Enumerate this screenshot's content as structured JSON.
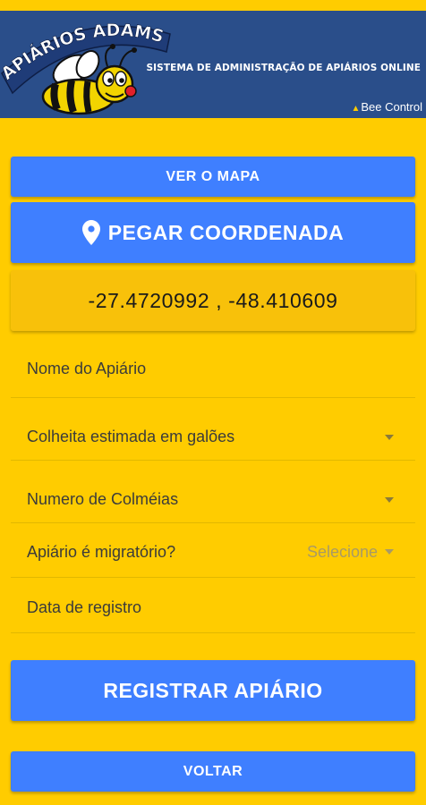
{
  "header": {
    "logo_text": "APIÁRIOS ADAMS",
    "tagline": "SISTEMA DE ADMINISTRAÇÃO DE APIÁRIOS ONLINE",
    "brand": "Bee Control"
  },
  "buttons": {
    "map_label": "VER O MAPA",
    "coord_label": "PEGAR COORDENADA",
    "register_label": "REGISTRAR APIÁRIO",
    "back_label": "VOLTAR"
  },
  "coordinates": "-27.4720992 , -48.410609",
  "form": {
    "apiary_name_placeholder": "Nome do Apiário",
    "harvest_placeholder": "Colheita estimada em galões",
    "hives_placeholder": "Numero de Colméias",
    "migratory_label": "Apiário é migratório?",
    "migratory_select": "Selecione",
    "date_placeholder": "Data de registro"
  },
  "colors": {
    "background": "#FFCC00",
    "header": "#2A4E8A",
    "button": "#3F7FFF",
    "coords_box": "#F8C10A"
  },
  "icons": [
    "map-pin-icon",
    "dropdown-caret-icon",
    "bee-mascot-icon"
  ]
}
